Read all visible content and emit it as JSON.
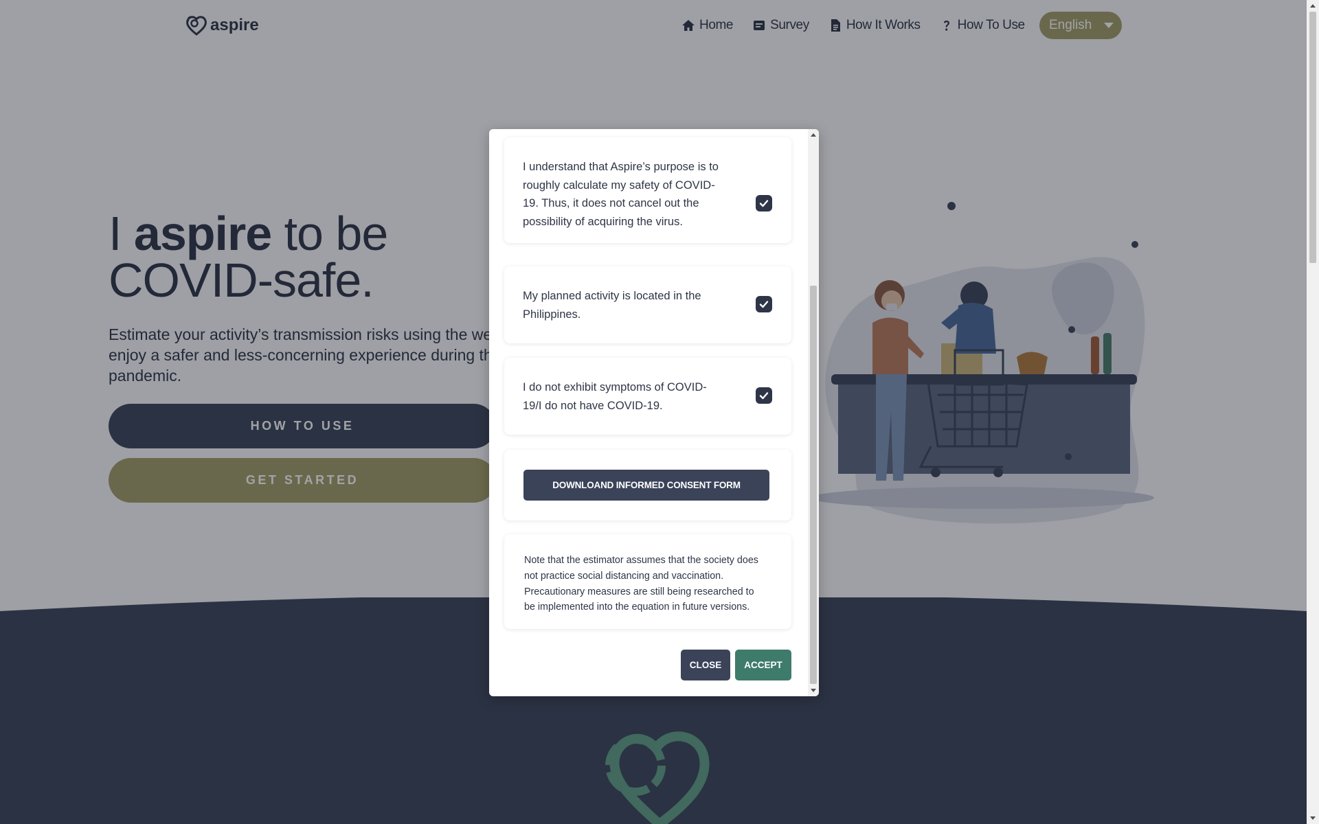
{
  "navbar": {
    "logo_text": "aspire",
    "links": [
      {
        "label": "Home",
        "icon": "home-icon"
      },
      {
        "label": "Survey",
        "icon": "survey-icon"
      },
      {
        "label": "How It Works",
        "icon": "document-icon"
      },
      {
        "label": "How To Use",
        "icon": "question-icon"
      }
    ],
    "language": "English"
  },
  "hero": {
    "title_pre": "I ",
    "title_bold": "aspire",
    "title_post": " to be",
    "title_line2": "COVID-safe.",
    "description_lines": [
      "Estimate your activity’s transmission risks using the webs",
      "enjoy a safer and less-concerning experience during the",
      "pandemic."
    ],
    "how_to_use_label": "HOW TO USE",
    "get_started_label": "GET STARTED"
  },
  "modal": {
    "items": [
      {
        "lines": [
          "I understand that Aspire’s purpose is to",
          "roughly calculate my safety of COVID-",
          "19. Thus, it does not cancel out the",
          "possibility of acquiring the virus."
        ],
        "checked": true
      },
      {
        "lines": [
          "My planned activity is located in the",
          "Philippines."
        ],
        "checked": true
      },
      {
        "lines": [
          "I do not exhibit symptoms of COVID-",
          "19/I do not have COVID-19."
        ],
        "checked": true
      }
    ],
    "download_label": "DOWNLOAND INFORMED CONSENT FORM",
    "note_lines": [
      "Note that the estimator assumes that the society does",
      "not practice social distancing and vaccination.",
      "Precautionary measures are still being researched to",
      "be implemented into the equation in future versions."
    ],
    "close_label": "CLOSE",
    "accept_label": "ACCEPT"
  },
  "colors": {
    "navy": "#2e3547",
    "button_navy": "#3b4359",
    "gold": "#a39d68",
    "teal": "#3f7b6b"
  }
}
